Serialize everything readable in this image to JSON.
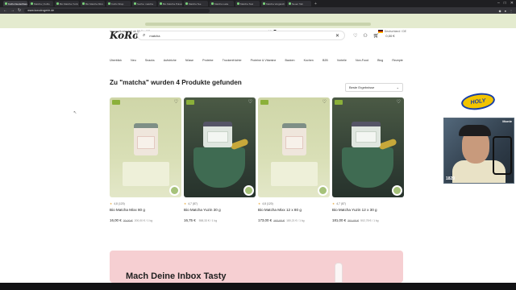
{
  "browser": {
    "tabs": [
      {
        "label": "KoRo Deutschland"
      },
      {
        "label": "Matcha | KoRo"
      },
      {
        "label": "Bio Matcha Yuzin"
      },
      {
        "label": "Bio Matcha Mixx"
      },
      {
        "label": "KoRo Shop"
      },
      {
        "label": "Suche: matcha"
      },
      {
        "label": "Bio Matcha Pulver"
      },
      {
        "label": "Matcha Tee"
      },
      {
        "label": "Matcha Latte"
      },
      {
        "label": "Matcha Test"
      },
      {
        "label": "Matcha Vergleich"
      },
      {
        "label": "Neuer Tab"
      }
    ],
    "new_tab": "+",
    "url": "www.korodrogerie.de",
    "controls": {
      "min": "–",
      "max": "□",
      "close": "✕"
    }
  },
  "info_bar": {
    "left": "Versandkostenfrei ab 59 € in DE",
    "stars": "★★★★★",
    "rating": "4,6",
    "right": "Deutschland / DE"
  },
  "header": {
    "logo": "KoRo",
    "search_value": "matcha",
    "search_placeholder": "Suche",
    "cart_total": "0,00 €"
  },
  "categories": [
    "Überblick",
    "Neu",
    "Snacks",
    "Aufstriche",
    "Nüsse",
    "Proteine",
    "Trockenfrüchte",
    "Proteine & Vitamine",
    "Backen",
    "Kochen",
    "B2B",
    "Vorteile",
    "Non-Food",
    "Blog",
    "Rezepte"
  ],
  "results": {
    "title": "Zu \"matcha\" wurden 4 Produkte gefunden",
    "sort_value": "Beste Ergebnisse"
  },
  "products": [
    {
      "rating": "4,8 (120)",
      "name": "Bio Matcha Mixx 80 g",
      "price": "16,00 €",
      "old_price": "20,00 €",
      "unit": "200,00 € / 1 kg",
      "style": "light"
    },
    {
      "rating": "4,7 (87)",
      "name": "Bio Matcha Yuzin 30 g",
      "price": "16,75 €",
      "old_price": "",
      "unit": "558,33 € / 1 kg",
      "style": "dark"
    },
    {
      "rating": "4,8 (120)",
      "name": "Bio Matcha Mixx 12 x 80 g",
      "price": "173,00 €",
      "old_price": "192,00 €",
      "unit": "180,21 € / 1 kg",
      "style": "light"
    },
    {
      "rating": "4,7 (87)",
      "name": "Bio Matcha Yuzin 12 x 30 g",
      "price": "181,00 €",
      "old_price": "201,00 €",
      "unit": "502,78 € / 1 kg",
      "style": "dark"
    }
  ],
  "newsletter": {
    "title": "Mach Deine Inbox Tasty"
  },
  "overlay": {
    "logo_text": "HOLY",
    "webcam_name": "Monte",
    "viewer_count": "1820"
  }
}
